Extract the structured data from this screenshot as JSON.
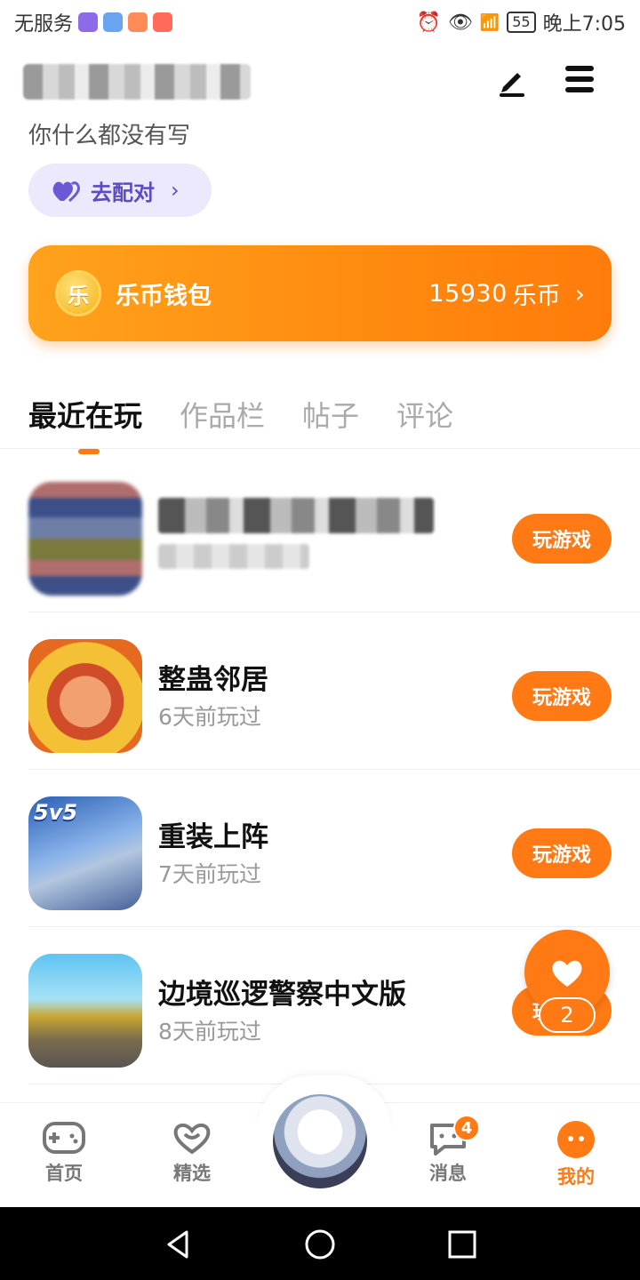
{
  "status_bar": {
    "carrier": "无服务",
    "battery": "55",
    "time": "晚上7:05"
  },
  "profile": {
    "bio": "你什么都没有写",
    "match_label": "去配对"
  },
  "wallet": {
    "title": "乐币钱包",
    "coin_glyph": "乐",
    "amount": "15930",
    "unit": "乐币",
    "accent": "#ff8a10"
  },
  "tabs": [
    {
      "label": "最近在玩",
      "active": true
    },
    {
      "label": "作品栏",
      "active": false
    },
    {
      "label": "帖子",
      "active": false
    },
    {
      "label": "评论",
      "active": false
    }
  ],
  "games": [
    {
      "name": "",
      "time": "",
      "play_label": "玩游戏",
      "redacted": true
    },
    {
      "name": "整蛊邻居",
      "time": "6天前玩过",
      "play_label": "玩游戏"
    },
    {
      "name": "重装上阵",
      "time": "7天前玩过",
      "play_label": "玩游戏",
      "icon_text": "5v5"
    },
    {
      "name": "边境巡逻警察中文版",
      "time": "8天前玩过",
      "play_label": "玩游戏"
    }
  ],
  "like": {
    "count": "2"
  },
  "bottom_nav": [
    {
      "label": "首页",
      "icon": "gamepad-icon"
    },
    {
      "label": "精选",
      "icon": "heart-outline-icon"
    },
    {
      "label": "消息",
      "icon": "chat-icon",
      "badge": "4"
    },
    {
      "label": "我的",
      "icon": "profile-face-icon",
      "active": true
    }
  ],
  "colors": {
    "accent": "#ff7a14",
    "match_bg": "#ebe9fb",
    "match_text": "#5b4bc4"
  }
}
